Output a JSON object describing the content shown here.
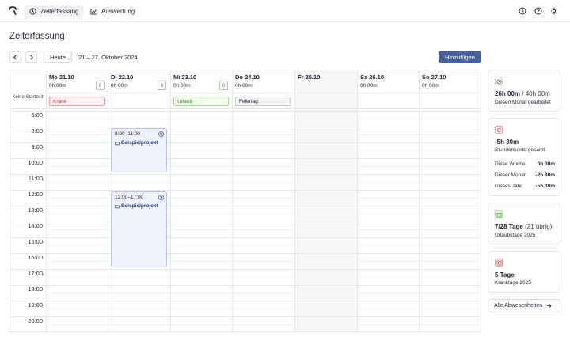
{
  "nav": {
    "tabs": [
      {
        "label": "Zeiterfassung",
        "icon": "clock-icon",
        "active": true
      },
      {
        "label": "Auswertung",
        "icon": "chart-icon",
        "active": false
      }
    ],
    "right_icons": [
      "clock-icon",
      "help-icon",
      "settings-icon"
    ]
  },
  "page": {
    "title": "Zeiterfassung"
  },
  "toolbar": {
    "prev_icon": "chevron-left-icon",
    "next_icon": "chevron-right-icon",
    "today_label": "Heute",
    "date_range": "21 – 27. Oktober 2024",
    "add_label": "Hinzufügen"
  },
  "calendar": {
    "no_start_label": "Keine Startzeit",
    "days": [
      {
        "name": "Mo 21.10",
        "hours": "0h 00m",
        "badge": "0",
        "absence": "Krank",
        "absence_type": "krank"
      },
      {
        "name": "Di 22.10",
        "hours": "8h 00m",
        "badge": "0",
        "absence": "",
        "absence_type": ""
      },
      {
        "name": "Mi 23.10",
        "hours": "0h 00m",
        "badge": "0",
        "absence": "Urlaub",
        "absence_type": "urlaub"
      },
      {
        "name": "Do 24.10",
        "hours": "0h 00m",
        "badge": "",
        "absence": "Feiertag",
        "absence_type": "feiertag"
      },
      {
        "name": "Fr 25.10",
        "hours": "",
        "badge": "",
        "absence": "",
        "absence_type": ""
      },
      {
        "name": "Sa 26.10",
        "hours": "0h 00m",
        "badge": "",
        "absence": "",
        "absence_type": ""
      },
      {
        "name": "So 27.10",
        "hours": "0h 00m",
        "badge": "",
        "absence": "",
        "absence_type": ""
      }
    ],
    "hours": [
      "6:00",
      "8:00",
      "9:00",
      "10:00",
      "11:00",
      "12:00",
      "13:00",
      "14:00",
      "15:00",
      "16:00",
      "17:00",
      "18:00",
      "19:00",
      "20:00"
    ],
    "events": [
      {
        "time": "8:00–11:00",
        "project": "Beispielprojekt",
        "day": "Di 22.10"
      },
      {
        "time": "12:00–17:00",
        "project": "Beispielprojekt",
        "day": "Di 22.10"
      }
    ]
  },
  "sidebar": {
    "worked": {
      "value": "26h 00m",
      "target": " / 40h 00m",
      "label": "Diesen Monat gearbeitet",
      "icon": "clock-icon"
    },
    "balance": {
      "value": "-5h 30m",
      "label": "Stundenkonto gesamt",
      "icon": "balance-icon",
      "rows": [
        {
          "label": "Diese Woche",
          "value": "0h 00m"
        },
        {
          "label": "Dieser Monat",
          "value": "-2h 30m"
        },
        {
          "label": "Dieses Jahr",
          "value": "-5h 30m"
        }
      ]
    },
    "vacation": {
      "value": "7/28 Tage",
      "extra": " (21 übrig)",
      "label": "Urlaubstage 2025",
      "icon": "calendar-icon"
    },
    "sick": {
      "value": "5 Tage",
      "label": "Kranktage 2025",
      "icon": "sick-icon"
    },
    "all_absences_label": "Alle Abwesenheiten"
  },
  "colors": {
    "accent": "#46609b",
    "event_bg": "#eef2fb",
    "event_border": "#b6c3e2",
    "sick": "#c23a3a",
    "vacation": "#3c8a2e",
    "badge": "#2f8a2a"
  }
}
